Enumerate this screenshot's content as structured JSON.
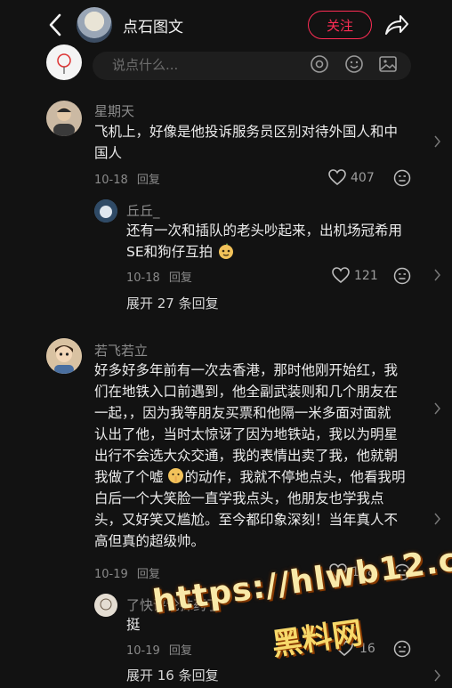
{
  "header": {
    "title": "点石图文",
    "follow_label": "关注"
  },
  "input": {
    "placeholder": "说点什么..."
  },
  "comments": [
    {
      "name": "星期天",
      "text_lines": [
        "飞机上，好像是他投诉服务员区别对待外国人和中",
        "国人"
      ],
      "date": "10-18",
      "reply_label": "回复",
      "likes": "407",
      "replies": [
        {
          "name": "丘丘_",
          "text_lines": [
            "还有一次和插队的老头吵起来，出机场冠希用",
            "SE和狗仔互拍"
          ],
          "date": "10-18",
          "reply_label": "回复",
          "likes": "121"
        }
      ],
      "expand_label": "展开 27 条回复"
    },
    {
      "name": "若飞若立",
      "text_lines": [
        "好多好多年前有一次去香港，那时他刚开始红，我",
        "们在地铁入口前遇到，他全副武装则和几个朋友在",
        "一起，，因为我等朋友买票和他隔一米多面对面就",
        "认出了他，当时太惊讶了因为地铁站，我以为明星",
        "出行不会选大众交通，我的表情出卖了我，他就朝",
        "我做了个嘘",
        "的动作，我就不停地点头，他看我明",
        "白后一个大笑脸一直学我点头，他朋友也学我点",
        "头，又好笑又尴尬。至今都印象深刻！当年真人不",
        "高但真的超级帅。"
      ],
      "date": "10-19",
      "reply_label": "回复",
      "likes": "168",
      "replies": [
        {
          "name": "了快评论抹药了",
          "text_lines": [
            "挺"
          ],
          "date": "10-19",
          "reply_label": "回复",
          "likes": "16"
        }
      ],
      "expand_label": "展开 16 条回复"
    }
  ],
  "watermark": {
    "url": "https://hlwb12.com",
    "site": "黑料网"
  }
}
